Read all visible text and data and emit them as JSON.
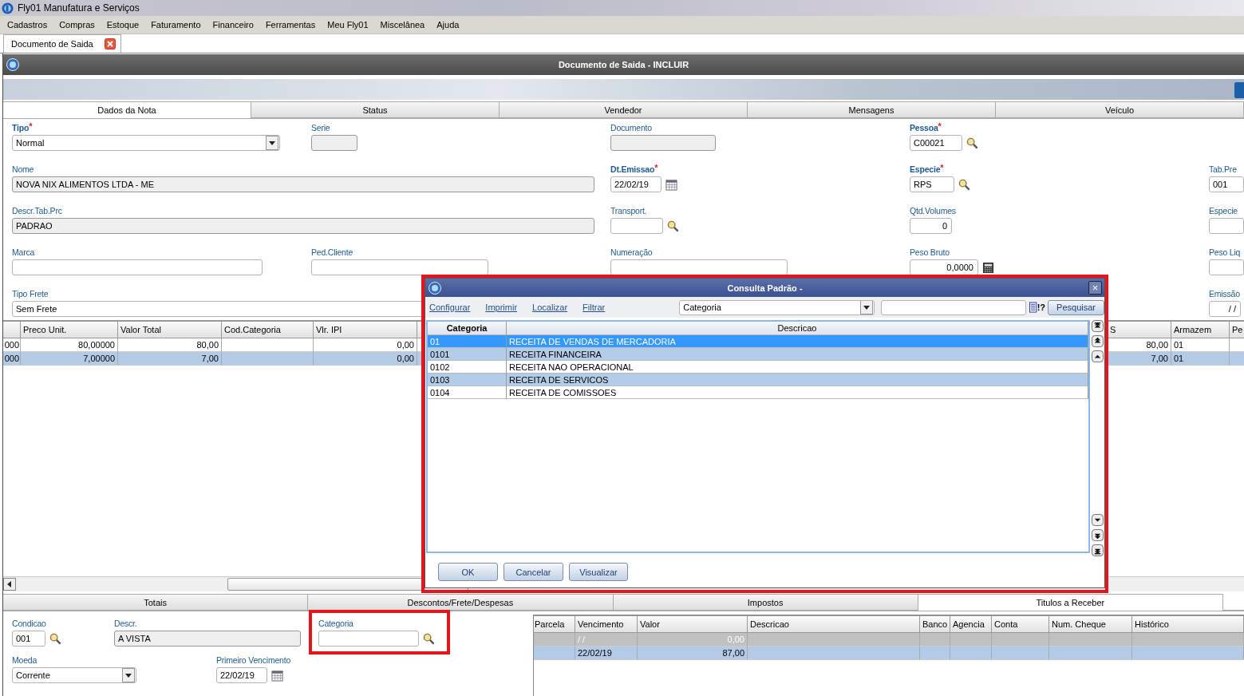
{
  "app": {
    "title": "Fly01 Manufatura e Serviços"
  },
  "menu": [
    "Cadastros",
    "Compras",
    "Estoque",
    "Faturamento",
    "Financeiro",
    "Ferramentas",
    "Meu Fly01",
    "Miscelânea",
    "Ajuda"
  ],
  "doc_tab": {
    "label": "Documento de Saida"
  },
  "window": {
    "title": "Documento de Saida - INCLUIR"
  },
  "required_mark": "*",
  "tabs": [
    {
      "label": "Dados da Nota",
      "selected": true
    },
    {
      "label": "Status",
      "selected": false
    },
    {
      "label": "Vendedor",
      "selected": false
    },
    {
      "label": "Mensagens",
      "selected": false
    },
    {
      "label": "Veículo",
      "selected": false
    }
  ],
  "fields": [
    {
      "label": "Tipo",
      "required": true,
      "kind": "select",
      "value": "Normal",
      "readonly": false
    },
    {
      "label": "Serie",
      "required": false,
      "kind": "text",
      "readonly": true
    },
    {
      "label": "Documento",
      "required": false,
      "kind": "text",
      "readonly": true
    },
    {
      "label": "Pessoa",
      "required": true,
      "kind": "lookup",
      "value": "C00021",
      "readonly": false
    },
    {
      "label": "Nome",
      "required": false,
      "kind": "text",
      "value": "NOVA NIX ALIMENTOS LTDA - ME",
      "readonly": true
    },
    {
      "label": "Dt.Emissao",
      "required": true,
      "kind": "date",
      "value": "22/02/19",
      "readonly": false
    },
    {
      "label": "Especie",
      "required": true,
      "kind": "lookup",
      "value": "RPS",
      "readonly": false
    },
    {
      "label": "Tab.Pre",
      "required": false,
      "kind": "text",
      "value": "001",
      "readonly": false
    },
    {
      "label": "Descr.Tab.Prc",
      "required": false,
      "kind": "text",
      "value": "PADRAO",
      "readonly": true
    },
    {
      "label": "Transport.",
      "required": false,
      "kind": "lookup",
      "readonly": false
    },
    {
      "label": "Qtd.Volumes",
      "required": false,
      "kind": "number",
      "value": "0",
      "readonly": false
    },
    {
      "label": "Especie",
      "required": false,
      "kind": "text",
      "readonly": false
    },
    {
      "label": "Marca",
      "required": false,
      "kind": "text",
      "readonly": false
    },
    {
      "label": "Ped.Cliente",
      "required": false,
      "kind": "text",
      "readonly": false
    },
    {
      "label": "Numeração",
      "required": false,
      "kind": "text",
      "readonly": false
    },
    {
      "label": "Peso Bruto",
      "required": false,
      "kind": "calc",
      "value": "0,0000",
      "readonly": false
    },
    {
      "label": "Peso Liq",
      "required": false,
      "kind": "text",
      "readonly": false
    },
    {
      "label": "Tipo Frete",
      "required": false,
      "kind": "text",
      "value": "Sem Frete",
      "readonly": false
    },
    {
      "label": "Emissão",
      "required": false,
      "kind": "number",
      "value": "/ /",
      "readonly": false
    }
  ],
  "items": {
    "columns": [
      {},
      {
        "label": "Preco Unit."
      },
      {
        "label": "Valor Total"
      },
      {
        "label": "Cod.Categoria"
      },
      {
        "label": "Vlr. IPI"
      },
      {},
      {
        "label": "S"
      },
      {
        "label": "Armazem"
      },
      {
        "label": "Pe"
      }
    ],
    "rows": [
      {
        "selected": false,
        "cells": [
          "000",
          "80,00000",
          "80,00",
          null,
          "0,00",
          null,
          "80,00",
          "01",
          null
        ]
      },
      {
        "selected": true,
        "cells": [
          "000",
          "7,00000",
          "7,00",
          null,
          "0,00",
          null,
          "7,00",
          "01",
          null
        ]
      }
    ]
  },
  "bottom_tabs": [
    {
      "label": "Totais",
      "selected": false
    },
    {
      "label": "Descontos/Frete/Despesas",
      "selected": false
    },
    {
      "label": "Impostos",
      "selected": false
    },
    {
      "label": "Titulos a Receber",
      "selected": true
    }
  ],
  "bottom_fields": [
    {
      "label": "Condicao",
      "kind": "lookup",
      "value": "001",
      "readonly": false
    },
    {
      "label": "Descr.",
      "kind": "text",
      "value": "A VISTA",
      "readonly": true
    },
    {
      "label": "Categoria",
      "kind": "lookup",
      "readonly": false
    },
    {
      "label": "Moeda",
      "kind": "select",
      "value": "Corrente",
      "readonly": false
    },
    {
      "label": "Primeiro Vencimento",
      "kind": "date",
      "value": "22/02/19",
      "readonly": false
    }
  ],
  "titles": {
    "columns": [
      "Parcela",
      "Vencimento",
      "Valor",
      "Descricao",
      "Banco",
      "Agencia",
      "Conta",
      "Num. Cheque",
      "Histórico"
    ],
    "rows": [
      {
        "selected": false,
        "disabled": true,
        "cells": [
          null,
          "/ /",
          "0,00",
          null,
          null,
          null,
          null,
          null,
          null
        ]
      },
      {
        "selected": true,
        "disabled": false,
        "cells": [
          null,
          "22/02/19",
          "87,00",
          null,
          null,
          null,
          null,
          null,
          null
        ]
      }
    ]
  },
  "dialog": {
    "title": "Consulta Padrão -",
    "close": "×",
    "links": [
      "Configurar",
      "Imprimir",
      "Localizar",
      "Filtrar"
    ],
    "search_by": "Categoria",
    "help_glyph": "!?",
    "search_button": "Pesquisar",
    "columns": [
      {
        "label": "Categoria",
        "sorted": true
      },
      {
        "label": "Descricao",
        "sorted": false
      }
    ],
    "rows": [
      {
        "code": "01",
        "description": "RECEITA DE VENDAS DE MERCADORIA",
        "selected": true
      },
      {
        "code": "0101",
        "description": "RECEITA FINANCEIRA",
        "selected": false
      },
      {
        "code": "0102",
        "description": "RECEITA NAO OPERACIONAL",
        "selected": false
      },
      {
        "code": "0103",
        "description": "RECEITA DE SERVICOS",
        "selected": false
      },
      {
        "code": "0104",
        "description": "RECEITA DE COMISSOES",
        "selected": false
      }
    ],
    "buttons": [
      "OK",
      "Cancelar",
      "Visualizar"
    ]
  }
}
